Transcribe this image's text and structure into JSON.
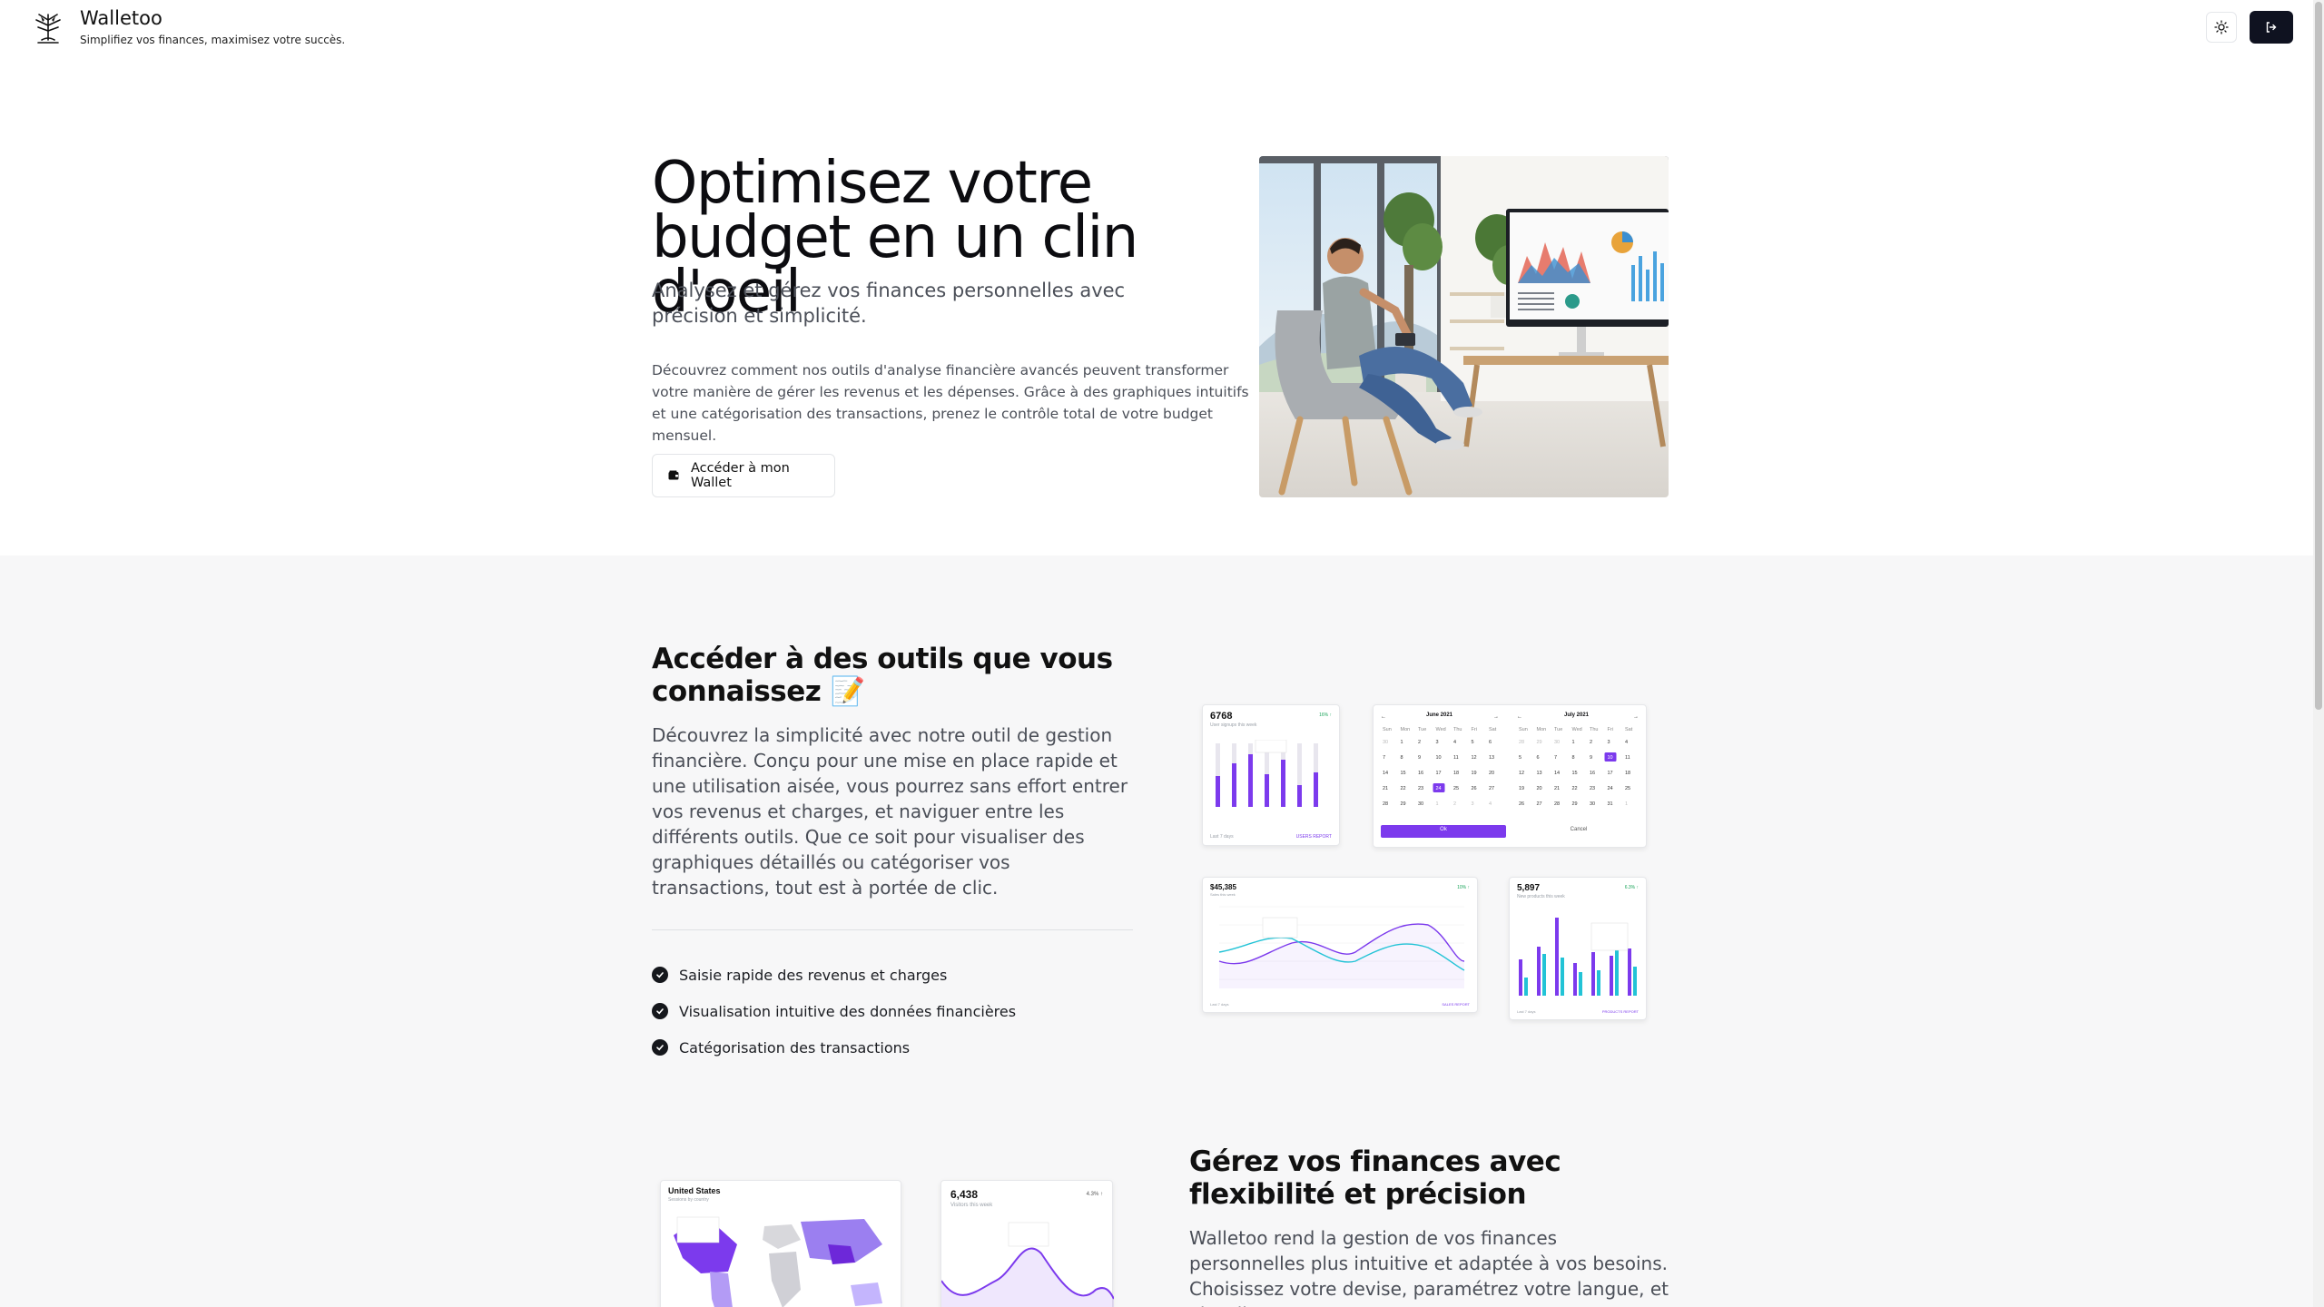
{
  "header": {
    "brand_title": "Walletoo",
    "brand_tagline": "Simplifiez vos finances, maximisez votre succès.",
    "theme_icon": "sun-icon",
    "login_icon": "login-icon"
  },
  "hero": {
    "title": "Optimisez votre budget en un clin d'oeil",
    "lead": "Analysez et gérez vos finances personnelles avec précision et simplicité.",
    "text": "Découvrez comment nos outils d'analyse financière avancés peuvent transformer votre manière de gérer les revenus et les dépenses. Grâce à des graphiques intuitifs et une catégorisation des transactions, prenez le contrôle total de votre budget mensuel.",
    "cta_label": "Accéder à mon Wallet",
    "cta_icon": "wallet-icon"
  },
  "tools": {
    "title": "Accéder à des outils que vous connaissez 📝",
    "text": "Découvrez la simplicité avec notre outil de gestion financière. Conçu pour une mise en place rapide et une utilisation aisée, vous pourrez sans effort entrer vos revenus et charges, et naviguer entre les différents outils. Que ce soit pour visualiser des graphiques détaillés ou catégoriser vos transactions, tout est à portée de clic.",
    "features": [
      "Saisie rapide des revenus et charges",
      "Visualisation intuitive des données financières",
      "Catégorisation des transactions"
    ]
  },
  "preview_cards": {
    "users": {
      "value": "6768",
      "caption": "User signups this week",
      "delta": "16% ↑",
      "footer": "Last 7 days",
      "link": "USERS REPORT"
    },
    "calendar": {
      "month1": "June 2021",
      "month2": "July 2021",
      "ok": "Ok",
      "cancel": "Cancel",
      "days": [
        "Sun",
        "Mon",
        "Tue",
        "Wed",
        "Thu",
        "Fri",
        "Sat"
      ]
    },
    "revenue": {
      "value": "$45,385",
      "caption": "Sales this week",
      "delta": "10% ↑",
      "footer": "Last 7 days",
      "link": "SALES REPORT"
    },
    "products": {
      "value": "5,897",
      "caption": "New products this week",
      "delta": "6.3% ↑",
      "footer": "Last 7 days",
      "link": "PRODUCTS REPORT"
    },
    "map": {
      "title": "United States",
      "caption": "Sessions by country"
    },
    "visitors": {
      "value": "6,438",
      "caption": "Visitors this week",
      "delta": "4.3% ↑"
    }
  },
  "flex": {
    "title": "Gérez vos finances avec flexibilité et précision",
    "text": "Walletoo rend la gestion de vos finances personnelles plus intuitive et adaptée à vos besoins. Choisissez votre devise, paramétrez votre langue, et visualisez vos"
  },
  "colors": {
    "accent": "#7c3aed",
    "teal": "#22c3d6",
    "dark": "#0f1220"
  }
}
